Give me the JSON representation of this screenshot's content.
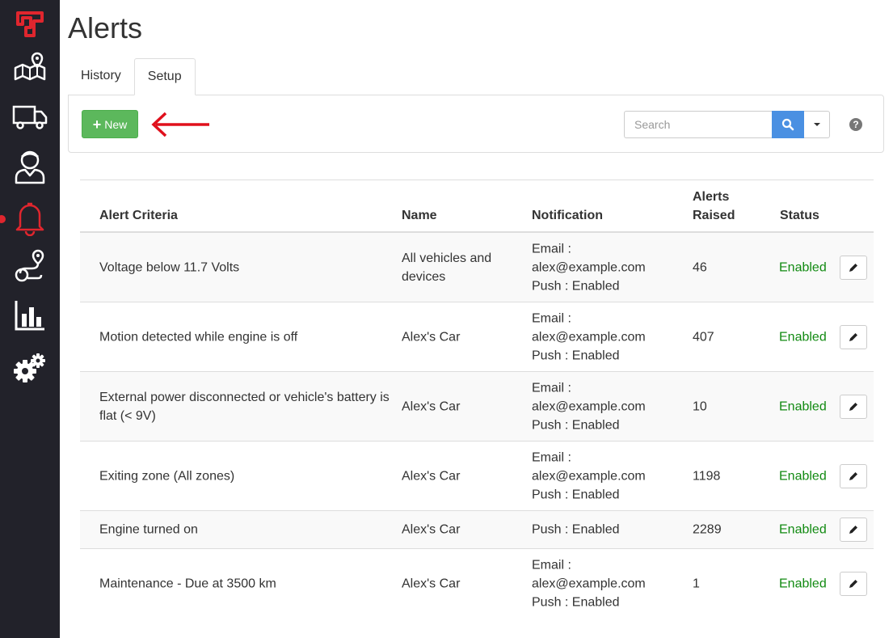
{
  "page": {
    "title": "Alerts"
  },
  "tabs": [
    {
      "label": "History",
      "active": false
    },
    {
      "label": "Setup",
      "active": true
    }
  ],
  "toolbar": {
    "new_label": "New",
    "search_placeholder": "Search",
    "help_label": "?"
  },
  "sidebar": {
    "items": [
      {
        "icon": "logo-icon"
      },
      {
        "icon": "map-icon"
      },
      {
        "icon": "truck-icon"
      },
      {
        "icon": "driver-icon"
      },
      {
        "icon": "bell-icon",
        "active": true
      },
      {
        "icon": "route-icon"
      },
      {
        "icon": "reports-icon"
      },
      {
        "icon": "settings-icon"
      }
    ]
  },
  "colors": {
    "sidebar_bg": "#22222a",
    "accent_red": "#e0262e",
    "new_button": "#5cb85c",
    "search_button": "#4a90e2",
    "status_enabled": "#118a11"
  },
  "table": {
    "columns": [
      "Alert Criteria",
      "Name",
      "Notification",
      "Alerts Raised",
      "Status"
    ],
    "alerts_raised_line1": "Alerts",
    "alerts_raised_line2": "Raised",
    "rows": [
      {
        "criteria": "Voltage below 11.7 Volts",
        "name": "All vehicles and devices",
        "notif": [
          "Email :",
          "alex@example.com",
          "Push : Enabled"
        ],
        "raised": "46",
        "status": "Enabled"
      },
      {
        "criteria": "Motion detected while engine is off",
        "name": "Alex's Car",
        "notif": [
          "Email :",
          "alex@example.com",
          "Push : Enabled"
        ],
        "raised": "407",
        "status": "Enabled"
      },
      {
        "criteria": "External power disconnected or vehicle's battery is flat (< 9V)",
        "name": "Alex's Car",
        "notif": [
          "Email :",
          "alex@example.com",
          "Push : Enabled"
        ],
        "raised": "10",
        "status": "Enabled"
      },
      {
        "criteria": "Exiting zone (All zones)",
        "name": "Alex's Car",
        "notif": [
          "Email :",
          "alex@example.com",
          "Push : Enabled"
        ],
        "raised": "1198",
        "status": "Enabled"
      },
      {
        "criteria": "Engine turned on",
        "name": "Alex's Car",
        "notif": [
          "Push : Enabled"
        ],
        "raised": "2289",
        "status": "Enabled"
      },
      {
        "criteria": "Maintenance - Due at 3500 km",
        "name": "Alex's Car",
        "notif": [
          "Email :",
          "alex@example.com",
          "Push : Enabled"
        ],
        "raised": "1",
        "status": "Enabled"
      }
    ]
  }
}
